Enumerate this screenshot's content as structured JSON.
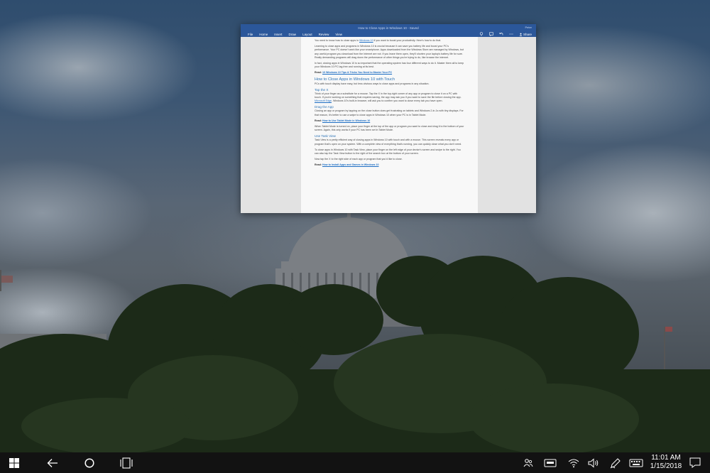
{
  "window": {
    "title": "How to Close Apps in Windows 10 - Saved",
    "account": "Peter"
  },
  "ribbon": {
    "tabs": [
      "File",
      "Home",
      "Insert",
      "Draw",
      "Layout",
      "Review",
      "View"
    ],
    "share_label": "Share"
  },
  "document": {
    "p1_pre": "You need to know how to close apps in ",
    "p1_link": "Windows 10",
    "p1_post": " if you want to boost your productivity. Here's how to do that.",
    "p2": "Learning to close apps and programs in Windows 10 is crucial because it can save you battery life and boost your PC's performance. Your PC doesn't work like your smartphone. Apps downloaded from the Windows Store are managed by Windows, but any useful program you download from the Internet are not. If you leave them open, they'll shorten your laptop's battery life for sure. Really demanding programs will drag down the performance of other things you're trying to do, like browse the internet.",
    "p3": "In fact, closing apps in Windows 10 is so important that the operating system has four different ways to do it. Master them all to keep your Windows 10 PC lag-free and running at its best.",
    "read1_label": "Read:",
    "read1_link": "10 Windows 10 Tips & Tricks You Need to Master Your PC",
    "h_touch": "How to Close Apps in Windows 10 with Touch",
    "p4": "PCs with touch display have easy, but less obvious ways to close apps and programs in any situation.",
    "h_tap": "Tap the X",
    "p5_pre": "Think of your finger as a substitute for a mouse. Tap the X in the top-right corner of any app or program to close it on a PC with touch. If you're working on something that requires saving, the app may ask you if you want to save the file before closing the app. ",
    "p5_link": "Microsoft Edge",
    "p5_post": ", Windows 10's built-in browser, will ask you to confirm you want to close every tab you have open.",
    "h_drag": "Drag the App",
    "p6": "Closing an app or program by tapping on the close button does get frustrating on tablets and Windows 2-in-1s with tiny displays. For that reason, it's better to use a swipe to close apps in Windows 10 when your PC is in Tablet Mode.",
    "read2_label": "Read:",
    "read2_link": "How to Use Tablet Mode in Windows 10",
    "p7": "When Tablet Mode is turned on, place your finger at the top of the app or program you want to close and drag it to the bottom of your screen. Again, this only works if your PC has been set in Tablet Mode.",
    "h_taskview": "Use Task View",
    "p8": "Task View is a pretty efficient way of closing apps in Windows 10 with touch and with a mouse. This screen reveals every app or program that's open on your system. With a complete view of everything that's running, you can quickly close what you don't need.",
    "p9": "To close apps in Windows 10 with Task View, place your finger on the left edge of your device's screen and swipe to the right. You can also tap the Task View button to the right of the search box at the bottom of your screen.",
    "p10": "Now tap the X to the right side of each app or program that you'd like to close.",
    "read3_label": "Read:",
    "read3_link": "How to Install Apps and Games in Windows 10"
  },
  "taskbar": {
    "time": "11:01 AM",
    "date": "1/15/2018",
    "icons": [
      "windows-start-icon",
      "back-arrow-icon",
      "cortana-circle-icon",
      "task-view-icon",
      "people-icon",
      "touch-keyboard-icon",
      "wifi-icon",
      "volume-icon",
      "pen-workspace-icon",
      "keyboard-icon",
      "action-center-icon"
    ]
  },
  "colors": {
    "word_blue": "#2b579a",
    "taskbar": "#121212",
    "heading_blue": "#2e74b5"
  }
}
